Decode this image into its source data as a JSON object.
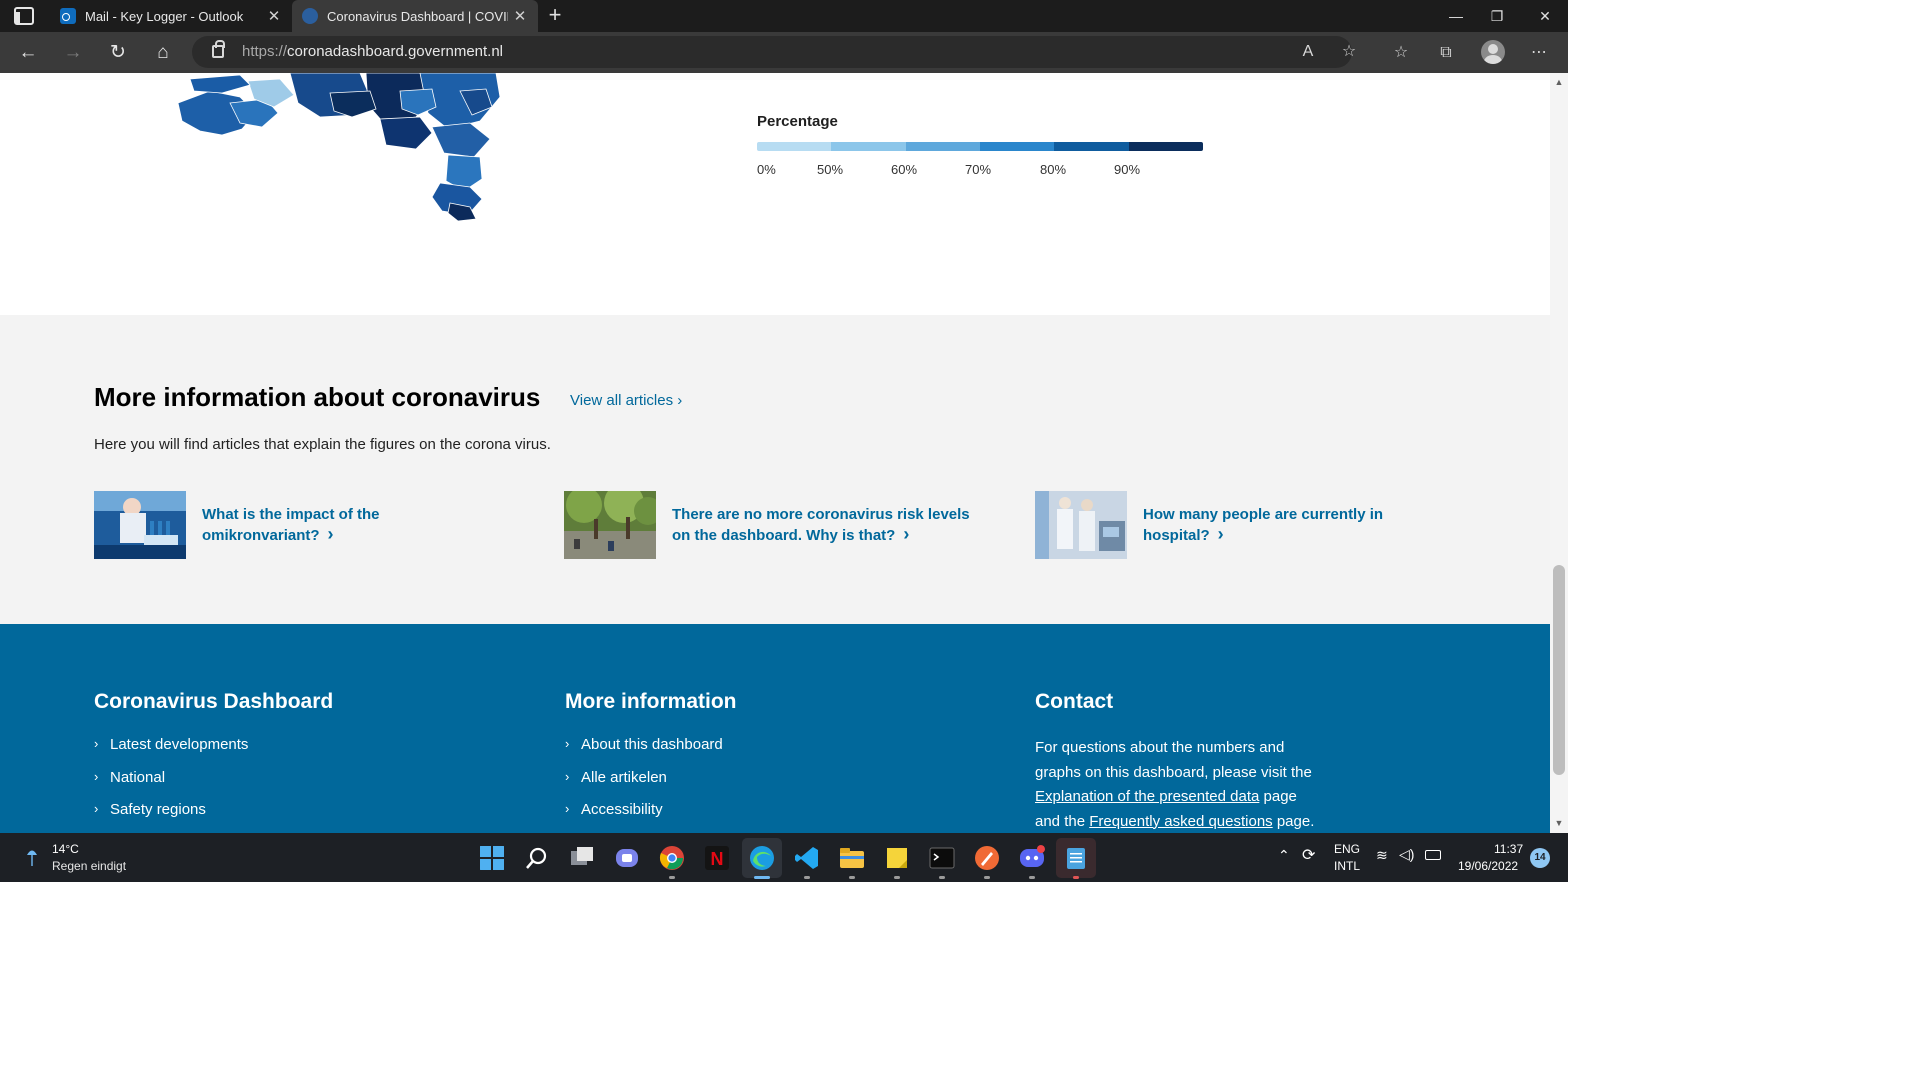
{
  "browser": {
    "tabs": [
      {
        "title": "Mail - Key Logger - Outlook",
        "active": false
      },
      {
        "title": "Coronavirus Dashboard | COVID",
        "active": true
      }
    ],
    "url": {
      "scheme": "https://",
      "host": "coronadashboard.government.nl"
    }
  },
  "legend": {
    "title": "Percentage",
    "ticks": [
      "0%",
      "50%",
      "60%",
      "70%",
      "80%",
      "90%"
    ],
    "colors": [
      "#b7dcf2",
      "#8cc6ea",
      "#5ea8dc",
      "#2a86cc",
      "#0f5c9e",
      "#0b2d5c"
    ]
  },
  "articles_section": {
    "title": "More information about coronavirus",
    "view_all": "View all articles",
    "intro": "Here you will find articles that explain the figures on the corona virus.",
    "articles": [
      {
        "title_line1": "What is the impact of the",
        "title_line2": "omikronvariant?"
      },
      {
        "title_line1": "There are no more coronavirus risk levels",
        "title_line2": "on the dashboard. Why is that?"
      },
      {
        "title_line1": "How many people are currently in",
        "title_line2": "hospital?"
      }
    ]
  },
  "footer": {
    "col1": {
      "heading": "Coronavirus Dashboard",
      "links": [
        "Latest developments",
        "National",
        "Safety regions"
      ]
    },
    "col2": {
      "heading": "More information",
      "links": [
        "About this dashboard",
        "Alle artikelen",
        "Accessibility"
      ]
    },
    "col3": {
      "heading": "Contact",
      "text_a": "For questions about the numbers and graphs on this dashboard, please visit the",
      "link_a": "Explanation of the presented data",
      "text_b": "page and the",
      "link_b": "Frequently asked questions",
      "text_c": "page."
    }
  },
  "taskbar": {
    "weather_temp": "14°C",
    "weather_desc": "Regen eindigt",
    "lang_top": "ENG",
    "lang_bottom": "INTL",
    "time": "11:37",
    "date": "19/06/2022",
    "notification_count": "14"
  }
}
